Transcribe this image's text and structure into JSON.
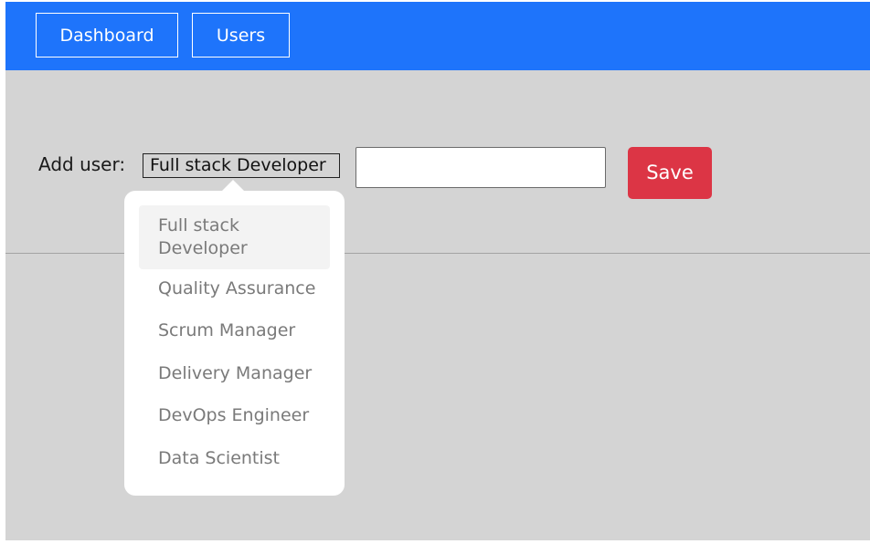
{
  "navbar": {
    "items": [
      {
        "label": "Dashboard"
      },
      {
        "label": "Users"
      }
    ],
    "color": "#1e74fb"
  },
  "form": {
    "add_label": "Add user:",
    "role_select": {
      "selected": "Full stack Developer",
      "options": [
        "Full stack Developer",
        "Quality Assurance",
        "Scrum Manager",
        "Delivery Manager",
        "DevOps Engineer",
        "Data Scientist"
      ]
    },
    "name_input": {
      "value": "",
      "placeholder": ""
    },
    "save_label": "Save",
    "save_color": "#dc3545"
  }
}
